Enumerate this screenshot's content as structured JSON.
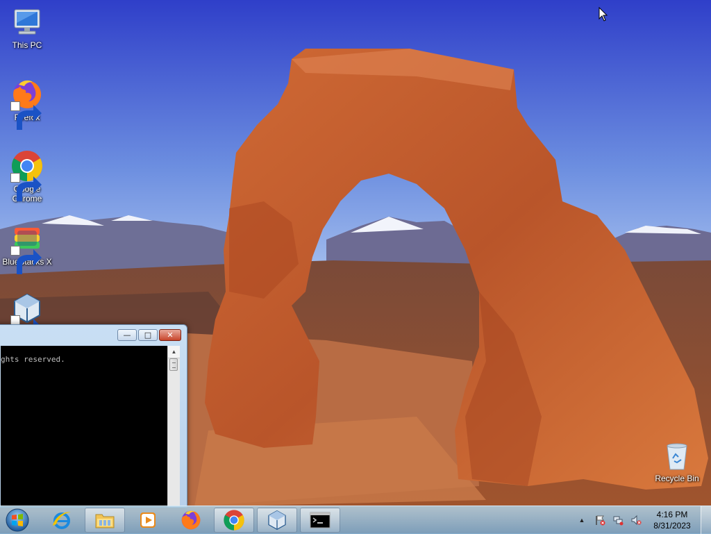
{
  "desktop": {
    "icons": [
      {
        "label": "This PC",
        "icon": "computer-icon"
      },
      {
        "label": "Firefox",
        "icon": "firefox-icon"
      },
      {
        "label": "Google Chrome",
        "icon": "chrome-icon"
      },
      {
        "label": "BlueStacks X",
        "icon": "bluestacks-icon"
      },
      {
        "label": "",
        "icon": "virtualbox-icon"
      },
      {
        "label": "Recycle Bin",
        "icon": "recycle-bin-icon"
      }
    ]
  },
  "console_window": {
    "text_line": "ghts reserved.",
    "minimize_glyph": "—",
    "maximize_glyph": "□",
    "close_glyph": "✕"
  },
  "taskbar": {
    "buttons": [
      {
        "name": "start-button",
        "icon": "windows-logo-icon"
      },
      {
        "name": "internet-explorer",
        "icon": "internet-explorer-icon",
        "running": false
      },
      {
        "name": "file-explorer",
        "icon": "folder-icon",
        "running": true
      },
      {
        "name": "media-player",
        "icon": "media-player-icon",
        "running": false
      },
      {
        "name": "firefox",
        "icon": "firefox-icon",
        "running": false
      },
      {
        "name": "chrome",
        "icon": "chrome-icon",
        "running": true
      },
      {
        "name": "virtualbox",
        "icon": "virtualbox-icon",
        "running": true
      },
      {
        "name": "command-prompt",
        "icon": "cmd-icon",
        "running": true
      }
    ],
    "tray": {
      "show_hidden_glyph": "▲",
      "time": "4:16 PM",
      "date": "8/31/2023"
    }
  },
  "colors": {
    "sky_top": "#3a4fd0",
    "sky_bottom": "#8fb2ee",
    "rock": "#c2592a",
    "taskbar": "#9cc3dc"
  }
}
